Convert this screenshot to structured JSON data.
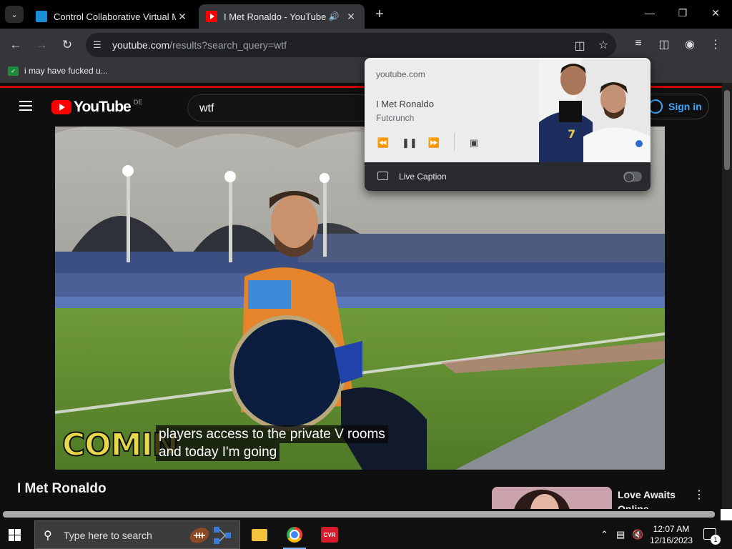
{
  "browser": {
    "tabs": [
      {
        "title": "Control Collaborative Virtual M",
        "favicon": "remote-desktop-icon"
      },
      {
        "title": "I Met Ronaldo - YouTube",
        "favicon": "youtube-icon",
        "audio": true
      }
    ],
    "address": {
      "host": "youtube.com",
      "path": "/results?search_query=wtf"
    },
    "bookmark": {
      "label": "i may have fucked u..."
    }
  },
  "youtube": {
    "country": "DE",
    "search_query": "wtf",
    "sign_in": "Sign in",
    "video": {
      "overlay_text": "COMIN",
      "caption_lines": [
        "players access to the private V rooms",
        "and today I'm going"
      ]
    },
    "title": "I Met Ronaldo",
    "recommendation": {
      "title": "Love Awaits Online"
    }
  },
  "media_popup": {
    "source": "youtube.com",
    "title": "I Met Ronaldo",
    "artist": "Futcrunch",
    "live_caption_label": "Live Caption",
    "live_caption_on": false
  },
  "taskbar": {
    "search_placeholder": "Type here to search",
    "time": "12:07 AM",
    "date": "12/16/2023",
    "notification_count": "1"
  },
  "colors": {
    "youtube_red": "#ff0000",
    "link_blue": "#3ea6ff",
    "chrome_dark": "#35363a"
  }
}
